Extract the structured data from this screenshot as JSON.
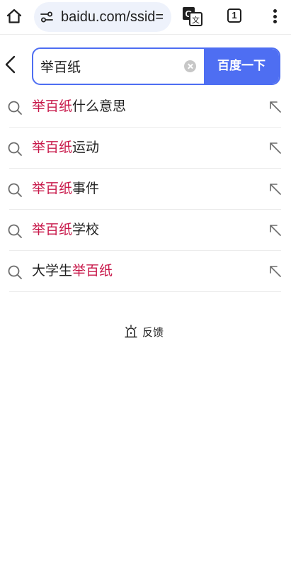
{
  "browser": {
    "url_text": "baidu.com/ssid=",
    "tab_count": "1",
    "icons": {
      "home": "home-icon",
      "site_settings": "tune-icon",
      "translate": "translate-icon",
      "tabs": "tab-switcher-icon",
      "menu": "more-vert-icon"
    }
  },
  "search": {
    "query": "举百纸",
    "submit_label": "百度一下",
    "back_icon": "chevron-left-icon",
    "clear_icon": "clear-icon",
    "accent_color": "#4e6ef2"
  },
  "suggestions": [
    {
      "pre": "",
      "hl": "举百纸",
      "post": "什么意思"
    },
    {
      "pre": "",
      "hl": "举百纸",
      "post": "运动"
    },
    {
      "pre": "",
      "hl": "举百纸",
      "post": "事件"
    },
    {
      "pre": "",
      "hl": "举百纸",
      "post": "学校"
    },
    {
      "pre": "大学生",
      "hl": "举百纸",
      "post": ""
    }
  ],
  "suggestion_icons": {
    "leading": "search-icon",
    "trailing": "arrow-up-left-icon"
  },
  "highlight_color": "#c8184a",
  "feedback": {
    "label": "反馈",
    "icon": "feedback-icon"
  }
}
